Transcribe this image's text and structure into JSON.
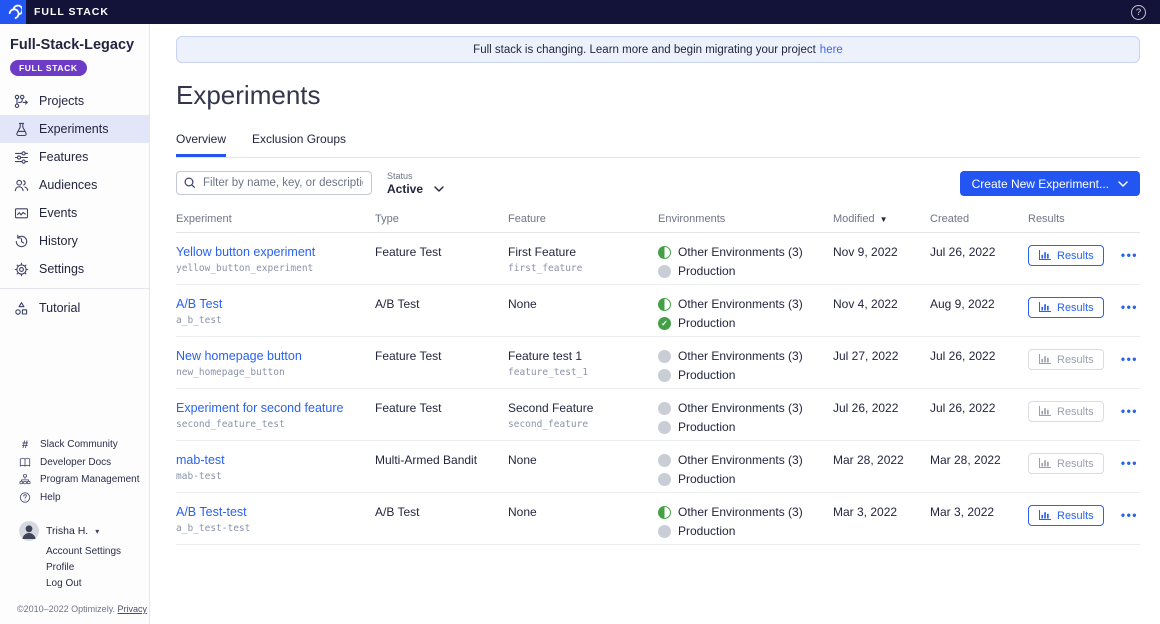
{
  "topbar": {
    "brand": "FULL STACK",
    "help": "?"
  },
  "sidebar": {
    "project_name": "Full-Stack-Legacy",
    "badge": "FULL STACK",
    "nav": [
      {
        "label": "Projects",
        "icon": "projects-icon",
        "active": false
      },
      {
        "label": "Experiments",
        "icon": "experiments-icon",
        "active": true
      },
      {
        "label": "Features",
        "icon": "features-icon",
        "active": false
      },
      {
        "label": "Audiences",
        "icon": "audiences-icon",
        "active": false
      },
      {
        "label": "Events",
        "icon": "events-icon",
        "active": false
      },
      {
        "label": "History",
        "icon": "history-icon",
        "active": false
      },
      {
        "label": "Settings",
        "icon": "settings-icon",
        "active": false,
        "divider_after": true
      },
      {
        "label": "Tutorial",
        "icon": "tutorial-icon",
        "active": false
      }
    ],
    "links": [
      {
        "label": "Slack Community",
        "icon": "hash-icon"
      },
      {
        "label": "Developer Docs",
        "icon": "book-icon"
      },
      {
        "label": "Program Management",
        "icon": "org-chart-icon"
      },
      {
        "label": "Help",
        "icon": "help-icon"
      }
    ],
    "user": {
      "name": "Trisha H.",
      "menu": [
        "Account Settings",
        "Profile",
        "Log Out"
      ]
    },
    "copyright": "©2010–2022 Optimizely.",
    "privacy_link": "Privacy"
  },
  "banner": {
    "text": "Full stack is changing. Learn more and begin migrating your project",
    "link": "here"
  },
  "page": {
    "title": "Experiments"
  },
  "tabs": [
    {
      "label": "Overview",
      "active": true
    },
    {
      "label": "Exclusion Groups",
      "active": false
    }
  ],
  "filters": {
    "search_placeholder": "Filter by name, key, or description",
    "status_label": "Status",
    "status_value": "Active"
  },
  "create_button_label": "Create New Experiment...",
  "table": {
    "headers": [
      "Experiment",
      "Type",
      "Feature",
      "Environments",
      "Modified",
      "Created",
      "Results"
    ],
    "sorted_by": "Modified",
    "results_label": "Results",
    "rows": [
      {
        "name": "Yellow button experiment",
        "key": "yellow_button_experiment",
        "type": "Feature Test",
        "feature": "First Feature",
        "feature_key": "first_feature",
        "envs": [
          {
            "label": "Other Environments (3)",
            "state": "partial"
          },
          {
            "label": "Production",
            "state": "paused"
          }
        ],
        "modified": "Nov 9, 2022",
        "created": "Jul 26, 2022",
        "results_enabled": true
      },
      {
        "name": "A/B Test",
        "key": "a_b_test",
        "type": "A/B Test",
        "feature": "None",
        "feature_key": "",
        "envs": [
          {
            "label": "Other Environments (3)",
            "state": "partial"
          },
          {
            "label": "Production",
            "state": "running"
          }
        ],
        "modified": "Nov 4, 2022",
        "created": "Aug 9, 2022",
        "results_enabled": true
      },
      {
        "name": "New homepage button",
        "key": "new_homepage_button",
        "type": "Feature Test",
        "feature": "Feature test 1",
        "feature_key": "feature_test_1",
        "envs": [
          {
            "label": "Other Environments (3)",
            "state": "paused"
          },
          {
            "label": "Production",
            "state": "paused"
          }
        ],
        "modified": "Jul 27, 2022",
        "created": "Jul 26, 2022",
        "results_enabled": false
      },
      {
        "name": "Experiment for second feature",
        "key": "second_feature_test",
        "type": "Feature Test",
        "feature": "Second Feature",
        "feature_key": "second_feature",
        "envs": [
          {
            "label": "Other Environments (3)",
            "state": "paused"
          },
          {
            "label": "Production",
            "state": "paused"
          }
        ],
        "modified": "Jul 26, 2022",
        "created": "Jul 26, 2022",
        "results_enabled": false
      },
      {
        "name": "mab-test",
        "key": "mab-test",
        "type": "Multi-Armed Bandit",
        "feature": "None",
        "feature_key": "",
        "envs": [
          {
            "label": "Other Environments (3)",
            "state": "paused"
          },
          {
            "label": "Production",
            "state": "paused"
          }
        ],
        "modified": "Mar 28, 2022",
        "created": "Mar 28, 2022",
        "results_enabled": false
      },
      {
        "name": "A/B Test-test",
        "key": "a_b_test-test",
        "type": "A/B Test",
        "feature": "None",
        "feature_key": "",
        "envs": [
          {
            "label": "Other Environments (3)",
            "state": "partial"
          },
          {
            "label": "Production",
            "state": "paused"
          }
        ],
        "modified": "Mar 3, 2022",
        "created": "Mar 3, 2022",
        "results_enabled": true
      }
    ]
  }
}
